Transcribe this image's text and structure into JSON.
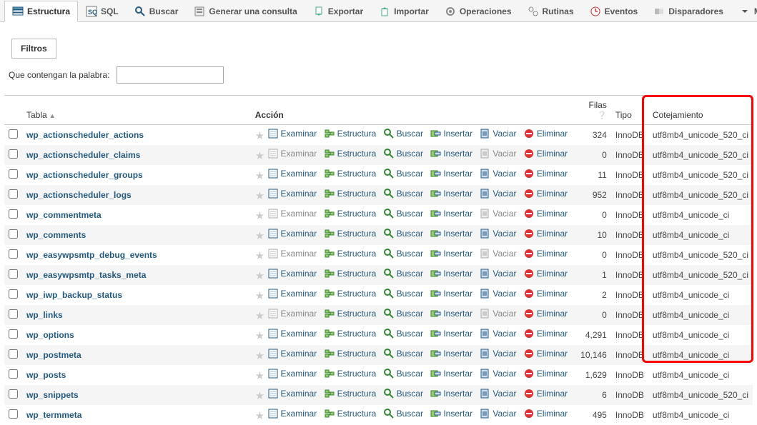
{
  "tabs": [
    {
      "label": "Estructura",
      "icon": "structure",
      "active": true
    },
    {
      "label": "SQL",
      "icon": "sql"
    },
    {
      "label": "Buscar",
      "icon": "search"
    },
    {
      "label": "Generar una consulta",
      "icon": "query"
    },
    {
      "label": "Exportar",
      "icon": "export"
    },
    {
      "label": "Importar",
      "icon": "import"
    },
    {
      "label": "Operaciones",
      "icon": "operations"
    },
    {
      "label": "Rutinas",
      "icon": "routines"
    },
    {
      "label": "Eventos",
      "icon": "events"
    },
    {
      "label": "Disparadores",
      "icon": "triggers"
    },
    {
      "label": "Má",
      "icon": "more"
    }
  ],
  "filters_label": "Filtros",
  "filter_prompt": "Que contengan la palabra:",
  "headers": {
    "tabla": "Tabla",
    "accion": "Acción",
    "filas": "Filas",
    "tipo": "Tipo",
    "cotejamiento": "Cotejamiento"
  },
  "actions": {
    "examinar": "Examinar",
    "estructura": "Estructura",
    "buscar": "Buscar",
    "insertar": "Insertar",
    "vaciar": "Vaciar",
    "eliminar": "Eliminar"
  },
  "rows": [
    {
      "name": "wp_actionscheduler_actions",
      "rows": "324",
      "tipo": "InnoDB",
      "cot": "utf8mb4_unicode_520_ci",
      "active": true
    },
    {
      "name": "wp_actionscheduler_claims",
      "rows": "0",
      "tipo": "InnoDB",
      "cot": "utf8mb4_unicode_520_ci",
      "active": false
    },
    {
      "name": "wp_actionscheduler_groups",
      "rows": "11",
      "tipo": "InnoDB",
      "cot": "utf8mb4_unicode_520_ci",
      "active": true
    },
    {
      "name": "wp_actionscheduler_logs",
      "rows": "952",
      "tipo": "InnoDB",
      "cot": "utf8mb4_unicode_520_ci",
      "active": true
    },
    {
      "name": "wp_commentmeta",
      "rows": "0",
      "tipo": "InnoDB",
      "cot": "utf8mb4_unicode_ci",
      "active": false
    },
    {
      "name": "wp_comments",
      "rows": "10",
      "tipo": "InnoDB",
      "cot": "utf8mb4_unicode_ci",
      "active": true
    },
    {
      "name": "wp_easywpsmtp_debug_events",
      "rows": "0",
      "tipo": "InnoDB",
      "cot": "utf8mb4_unicode_520_ci",
      "active": false
    },
    {
      "name": "wp_easywpsmtp_tasks_meta",
      "rows": "1",
      "tipo": "InnoDB",
      "cot": "utf8mb4_unicode_520_ci",
      "active": true
    },
    {
      "name": "wp_iwp_backup_status",
      "rows": "2",
      "tipo": "InnoDB",
      "cot": "utf8mb4_unicode_ci",
      "active": true
    },
    {
      "name": "wp_links",
      "rows": "0",
      "tipo": "InnoDB",
      "cot": "utf8mb4_unicode_ci",
      "active": false
    },
    {
      "name": "wp_options",
      "rows": "4,291",
      "tipo": "InnoDB",
      "cot": "utf8mb4_unicode_ci",
      "active": true
    },
    {
      "name": "wp_postmeta",
      "rows": "10,146",
      "tipo": "InnoDB",
      "cot": "utf8mb4_unicode_ci",
      "active": true
    },
    {
      "name": "wp_posts",
      "rows": "1,629",
      "tipo": "InnoDB",
      "cot": "utf8mb4_unicode_ci",
      "active": true
    },
    {
      "name": "wp_snippets",
      "rows": "6",
      "tipo": "InnoDB",
      "cot": "utf8mb4_unicode_520_ci",
      "active": true
    },
    {
      "name": "wp_termmeta",
      "rows": "495",
      "tipo": "InnoDB",
      "cot": "utf8mb4_unicode_ci",
      "active": true
    }
  ]
}
